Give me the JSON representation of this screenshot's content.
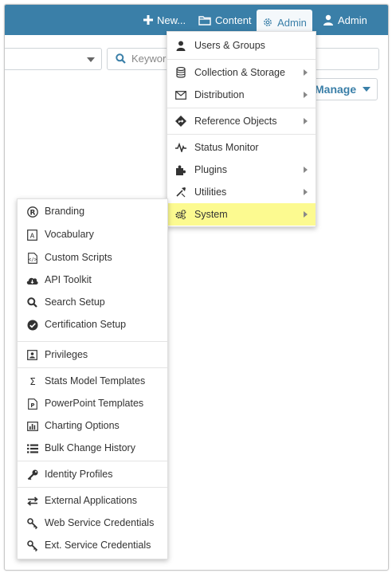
{
  "topbar": {
    "new_label": "New...",
    "content_label": "Content",
    "admin_tab_label": "Admin",
    "user_label": "Admin"
  },
  "search": {
    "placeholder": "Keywor"
  },
  "manage_button": {
    "label": "Manage"
  },
  "admin_menu": {
    "items": [
      {
        "label": "Users & Groups",
        "icon": "user-icon"
      },
      {
        "label": "Collection & Storage",
        "icon": "database-icon"
      },
      {
        "label": "Distribution",
        "icon": "envelope-icon"
      },
      {
        "label": "Reference Objects",
        "icon": "directions-icon"
      },
      {
        "label": "Status Monitor",
        "icon": "heartbeat-icon"
      },
      {
        "label": "Plugins",
        "icon": "puzzle-icon"
      },
      {
        "label": "Utilities",
        "icon": "wrench-icon"
      },
      {
        "label": "System",
        "icon": "gears-icon"
      }
    ],
    "highlight_color": "#fcfa90"
  },
  "system_menu": {
    "items": [
      {
        "label": "Branding",
        "icon": "registered-icon"
      },
      {
        "label": "Vocabulary",
        "icon": "font-icon"
      },
      {
        "label": "Custom Scripts",
        "icon": "code-file-icon"
      },
      {
        "label": "API Toolkit",
        "icon": "cloud-download-icon"
      },
      {
        "label": "Search Setup",
        "icon": "search-icon"
      },
      {
        "label": "Certification Setup",
        "icon": "check-badge-icon"
      },
      {
        "label": "Privileges",
        "icon": "id-badge-icon"
      },
      {
        "label": "Stats Model Templates",
        "icon": "sigma-icon"
      },
      {
        "label": "PowerPoint Templates",
        "icon": "powerpoint-icon"
      },
      {
        "label": "Charting Options",
        "icon": "bar-chart-icon"
      },
      {
        "label": "Bulk Change History",
        "icon": "list-icon"
      },
      {
        "label": "Identity Profiles",
        "icon": "key-icon"
      },
      {
        "label": "External Applications",
        "icon": "exchange-icon"
      },
      {
        "label": "Web Service Credentials",
        "icon": "key-outline-icon"
      },
      {
        "label": "Ext. Service Credentials",
        "icon": "key-outline-icon"
      }
    ]
  },
  "colors": {
    "brand": "#3a7fa8",
    "menu_text": "#333333"
  }
}
